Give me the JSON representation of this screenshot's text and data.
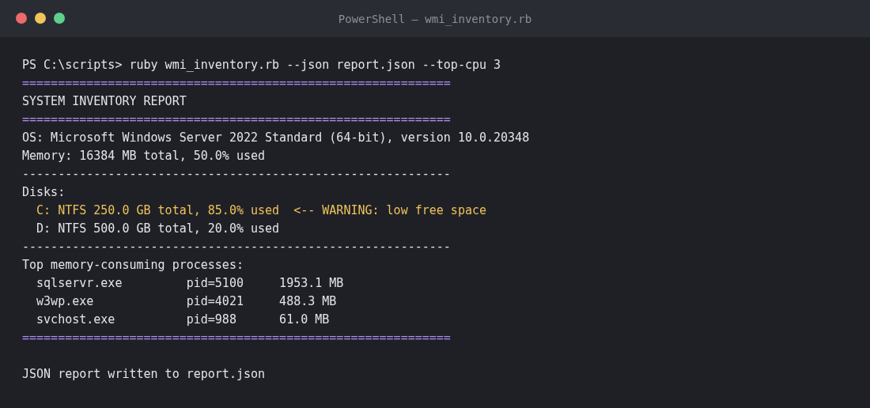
{
  "window": {
    "title": "PowerShell — wmi_inventory.rb"
  },
  "lines": [
    {
      "kind": "prompt",
      "text": "PS C:\\scripts> ruby wmi_inventory.rb --json report.json --top-cpu 3"
    },
    {
      "kind": "rule",
      "text": "============================================================"
    },
    {
      "kind": "plain",
      "text": "SYSTEM INVENTORY REPORT"
    },
    {
      "kind": "rule",
      "text": "============================================================"
    },
    {
      "kind": "plain",
      "text": "OS: Microsoft Windows Server 2022 Standard (64-bit), version 10.0.20348"
    },
    {
      "kind": "plain",
      "text": "Memory: 16384 MB total, 50.0% used"
    },
    {
      "kind": "plain",
      "text": "------------------------------------------------------------"
    },
    {
      "kind": "plain",
      "text": "Disks:"
    },
    {
      "kind": "warning",
      "text": "  C: NTFS 250.0 GB total, 85.0% used  <-- WARNING: low free space"
    },
    {
      "kind": "plain",
      "text": "  D: NTFS 500.0 GB total, 20.0% used"
    },
    {
      "kind": "plain",
      "text": "------------------------------------------------------------"
    },
    {
      "kind": "plain",
      "text": "Top memory-consuming processes:"
    },
    {
      "kind": "plain",
      "text": "  sqlservr.exe         pid=5100     1953.1 MB"
    },
    {
      "kind": "plain",
      "text": "  w3wp.exe             pid=4021     488.3 MB"
    },
    {
      "kind": "plain",
      "text": "  svchost.exe          pid=988      61.0 MB"
    },
    {
      "kind": "rule",
      "text": "============================================================"
    },
    {
      "kind": "blank"
    },
    {
      "kind": "plain",
      "text": "JSON report written to report.json"
    }
  ]
}
